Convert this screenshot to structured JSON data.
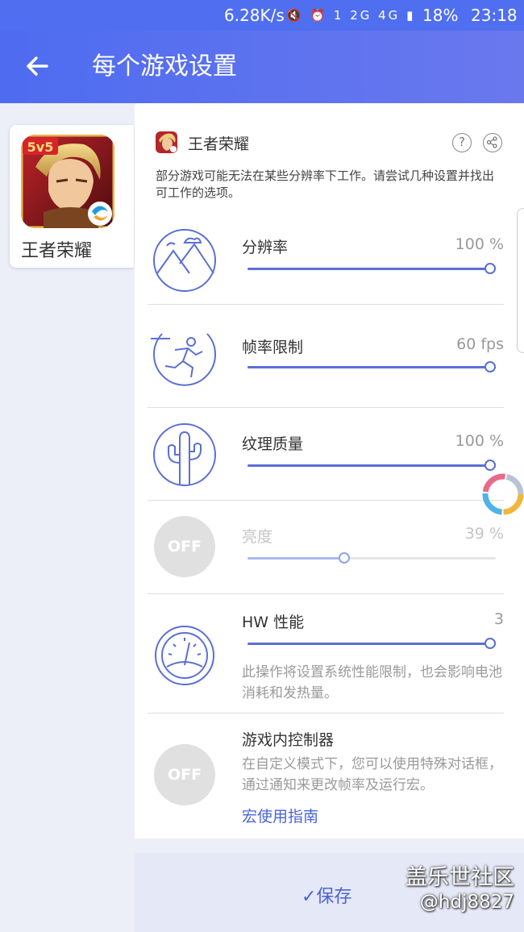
{
  "status_bar": {
    "network_speed": "6.28K/s",
    "icons": [
      "mute-icon",
      "alarm-icon",
      "sim-1-icon",
      "2g-signal-icon",
      "4g-icon",
      "signal-icon"
    ],
    "icons_text": "🔇 ⏰ 1 2G 4G ▮",
    "battery": "18%",
    "time": "23:18"
  },
  "app_bar": {
    "back_icon": "arrow-left-icon",
    "title": "每个游戏设置"
  },
  "left_card": {
    "game_name": "王者荣耀"
  },
  "panel": {
    "game_name": "王者荣耀",
    "help_icon": "?",
    "note": "部分游戏可能无法在某些分辨率下工作。请尝试几种设置并找出可工作的选项。",
    "settings": [
      {
        "icon": "landscape-icon",
        "label": "分辨率",
        "value": "100 %",
        "level_percent": 100
      },
      {
        "icon": "runner-icon",
        "label": "帧率限制",
        "value": "60 fps",
        "level_percent": 100
      },
      {
        "icon": "cactus-icon",
        "label": "纹理质量",
        "value": "100 %",
        "level_percent": 100
      },
      {
        "icon": "brightness-off-icon",
        "icon_text": "OFF",
        "label": "亮度",
        "value": "39 %",
        "level_percent": 39
      },
      {
        "icon": "speedometer-icon",
        "label": "HW 性能",
        "value": "3",
        "level_percent": 100,
        "description": "此操作将设置系统性能限制，也会影响电池消耗和发热量。"
      },
      {
        "icon": "controller-off-icon",
        "icon_text": "OFF",
        "label": "游戏内控制器",
        "description": "在自定义模式下，您可以使用特殊对话框，通过通知来更改帧率及运行宏。",
        "link": "宏使用指南"
      }
    ]
  },
  "save": {
    "label": "✓保存"
  },
  "watermark": {
    "line1": "盖乐世社区",
    "line2": "@hdj8827"
  },
  "colors": {
    "app_bar": "#4e6cf0",
    "accent": "#5a6fd6",
    "link": "#4a63d8"
  }
}
